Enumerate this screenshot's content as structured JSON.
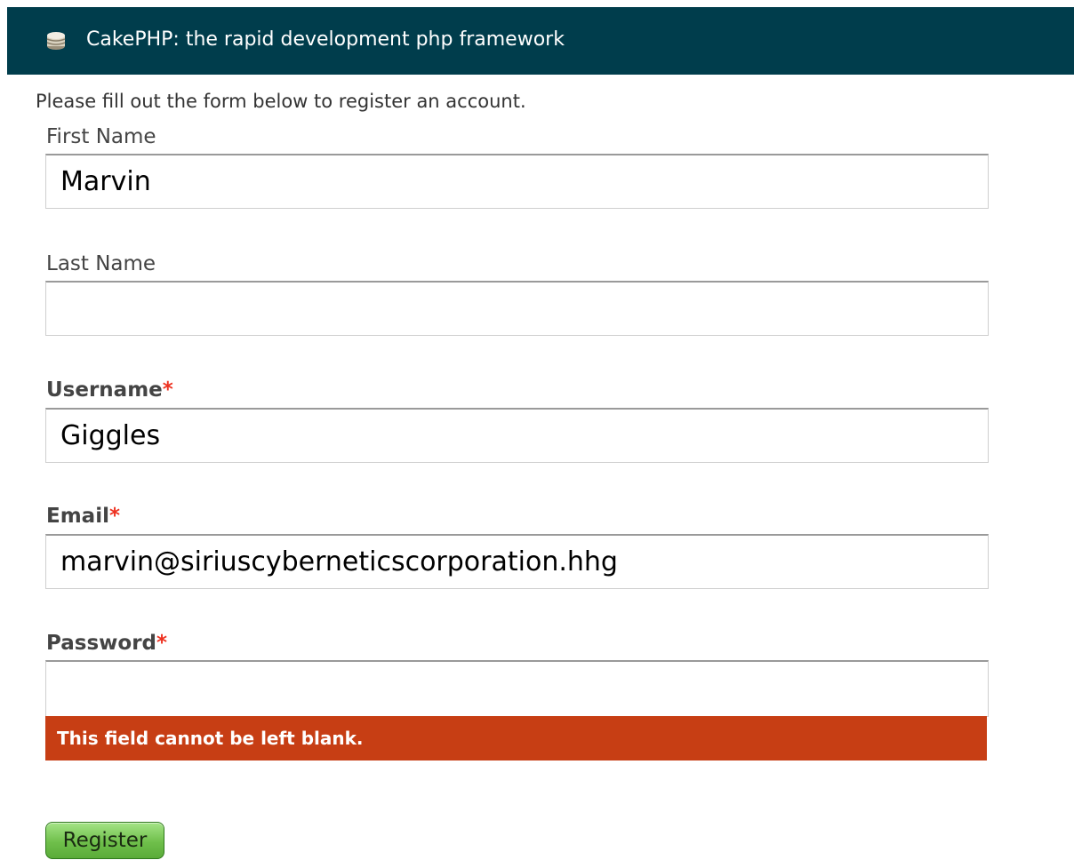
{
  "header": {
    "title": "CakePHP: the rapid development php framework",
    "logo_icon": "cake-icon",
    "background": "#003d4c"
  },
  "intro": "Please fill out the form below to register an account.",
  "form": {
    "first_name": {
      "label": "First Name",
      "value": "Marvin"
    },
    "last_name": {
      "label": "Last Name",
      "value": ""
    },
    "username": {
      "label": "Username",
      "required_mark": "*",
      "value": "Giggles"
    },
    "email": {
      "label": "Email",
      "required_mark": "*",
      "value": "marvin@siriuscyberneticscorporation.hhg"
    },
    "password": {
      "label": "Password",
      "required_mark": "*",
      "value": "",
      "error": "This field cannot be left blank."
    },
    "submit_label": "Register"
  },
  "colors": {
    "error_bg": "#c73e14",
    "required": "#ee3322",
    "submit_green": "#6fbf4b"
  }
}
